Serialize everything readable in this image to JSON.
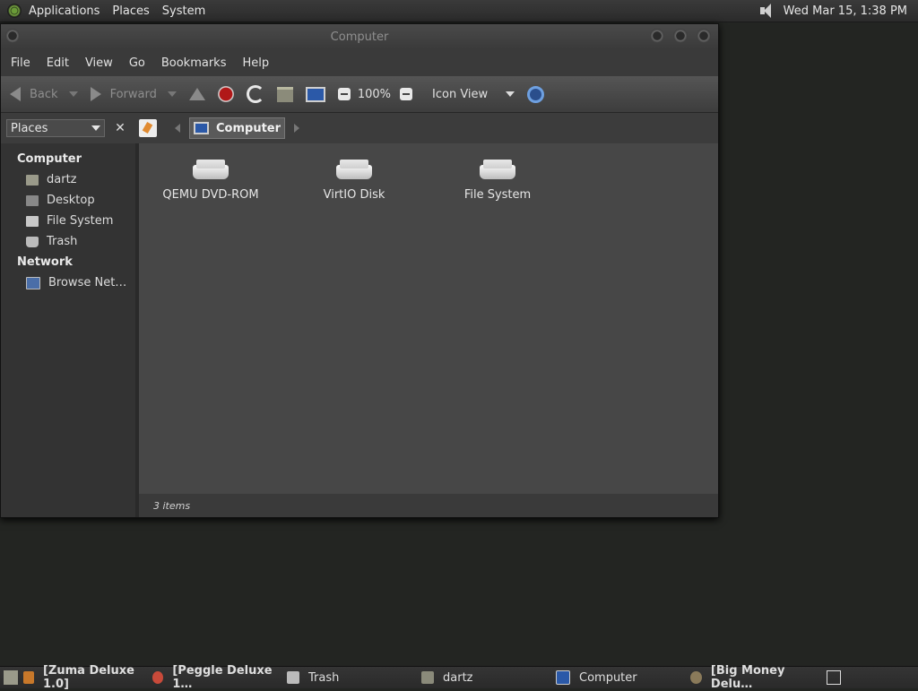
{
  "top_panel": {
    "menus": [
      "Applications",
      "Places",
      "System"
    ],
    "clock": "Wed Mar 15,  1:38 PM"
  },
  "window": {
    "title": "Computer",
    "menubar": [
      "File",
      "Edit",
      "View",
      "Go",
      "Bookmarks",
      "Help"
    ],
    "toolbar": {
      "back": "Back",
      "forward": "Forward",
      "zoom": "100%",
      "view_mode": "Icon View"
    },
    "location": {
      "places_label": "Places",
      "crumb": "Computer"
    },
    "sidebar": {
      "computer_heading": "Computer",
      "computer_items": [
        "dartz",
        "Desktop",
        "File System",
        "Trash"
      ],
      "network_heading": "Network",
      "network_items": [
        "Browse Net…"
      ]
    },
    "files": [
      "QEMU DVD-ROM",
      "VirtIO Disk",
      "File System"
    ],
    "status": "3 items"
  },
  "taskbar": [
    "[Zuma Deluxe 1.0]",
    "[Peggle Deluxe 1…",
    "Trash",
    "dartz",
    "Computer",
    "[Big Money Delu…"
  ]
}
